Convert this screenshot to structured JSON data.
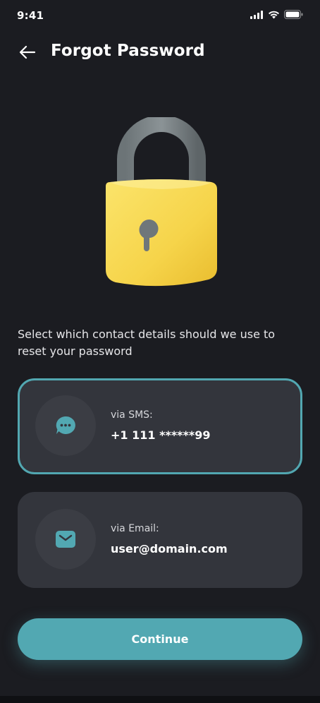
{
  "status_bar": {
    "time": "9:41"
  },
  "header": {
    "title": "Forgot Password"
  },
  "prompt": "Select which contact details should we use to reset your password",
  "options": [
    {
      "label": "via SMS:",
      "value": "+1 111 ******99",
      "icon": "chat-bubble-icon",
      "selected": true
    },
    {
      "label": "via Email:",
      "value": "user@domain.com",
      "icon": "mail-icon",
      "selected": false
    }
  ],
  "continue_label": "Continue",
  "colors": {
    "accent": "#52a8b2",
    "background": "#1b1c21",
    "card": "#33353c",
    "lock_body": "#f7d64f",
    "lock_shackle": "#7a8285"
  }
}
